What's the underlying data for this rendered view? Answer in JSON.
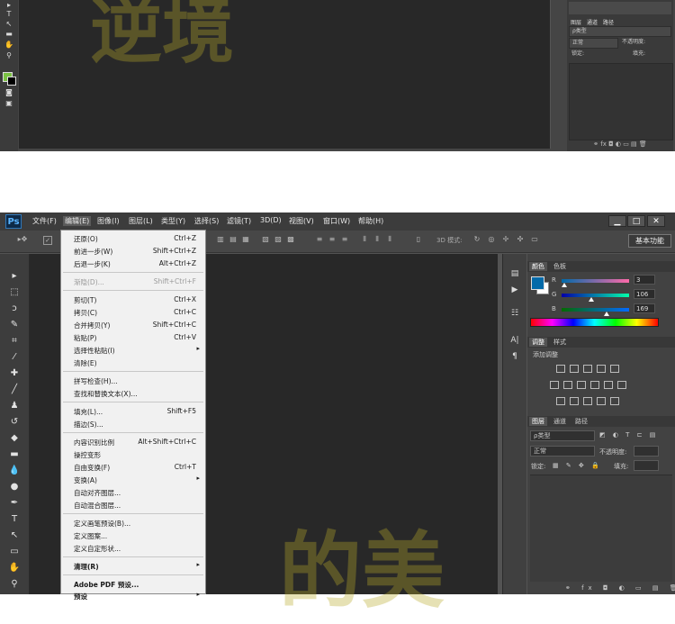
{
  "top_window": {
    "panel_tabs": [
      "图层",
      "通道",
      "路径"
    ],
    "panel_rows": [
      "ρ类型",
      "正常",
      "不透明度:",
      "锁定:",
      "填充:"
    ]
  },
  "app": {
    "logo": "Ps",
    "menus": [
      "文件(F)",
      "编辑(E)",
      "图像(I)",
      "图层(L)",
      "类型(Y)",
      "选择(S)",
      "滤镜(T)",
      "3D(D)",
      "视图(V)",
      "窗口(W)",
      "帮助(H)"
    ],
    "active_menu": "编辑(E)",
    "window_buttons": {
      "minimize": "▁",
      "maximize": "□",
      "close": "✕"
    }
  },
  "options_bar": {
    "mode_3d_label": "3D 模式:",
    "workspace_button": "基本功能"
  },
  "edit_menu": {
    "items": [
      {
        "label": "还原(O)",
        "shortcut": "Ctrl+Z"
      },
      {
        "label": "前进一步(W)",
        "shortcut": "Shift+Ctrl+Z"
      },
      {
        "label": "后退一步(K)",
        "shortcut": "Alt+Ctrl+Z"
      },
      {
        "label": "渐隐(D)...",
        "shortcut": "Shift+Ctrl+F"
      },
      {
        "label": "剪切(T)",
        "shortcut": "Ctrl+X"
      },
      {
        "label": "拷贝(C)",
        "shortcut": "Ctrl+C"
      },
      {
        "label": "合并拷贝(Y)",
        "shortcut": "Shift+Ctrl+C"
      },
      {
        "label": "粘贴(P)",
        "shortcut": "Ctrl+V"
      },
      {
        "label": "选择性粘贴(I)",
        "shortcut": ""
      },
      {
        "label": "清除(E)",
        "shortcut": ""
      },
      {
        "label": "拼写检查(H)...",
        "shortcut": ""
      },
      {
        "label": "查找和替换文本(X)...",
        "shortcut": ""
      },
      {
        "label": "填充(L)...",
        "shortcut": "Shift+F5"
      },
      {
        "label": "描边(S)...",
        "shortcut": ""
      },
      {
        "label": "内容识别比例",
        "shortcut": "Alt+Shift+Ctrl+C"
      },
      {
        "label": "操控变形",
        "shortcut": ""
      },
      {
        "label": "自由变换(F)",
        "shortcut": "Ctrl+T"
      },
      {
        "label": "变换(A)",
        "shortcut": ""
      },
      {
        "label": "自动对齐图层...",
        "shortcut": ""
      },
      {
        "label": "自动混合图层...",
        "shortcut": ""
      },
      {
        "label": "定义画笔预设(B)...",
        "shortcut": ""
      },
      {
        "label": "定义图案...",
        "shortcut": ""
      },
      {
        "label": "定义自定形状...",
        "shortcut": ""
      },
      {
        "label": "清理(R)",
        "shortcut": ""
      },
      {
        "label": "Adobe PDF 预设...",
        "shortcut": ""
      },
      {
        "label": "预设",
        "shortcut": ""
      }
    ]
  },
  "color_panel": {
    "tabs": [
      "颜色",
      "色板"
    ],
    "r_label": "R",
    "r_value": "3",
    "g_label": "G",
    "g_value": "106",
    "b_label": "B",
    "b_value": "169",
    "foreground": "#036aa9"
  },
  "adjustments_panel": {
    "tabs": [
      "调整",
      "样式"
    ],
    "title": "添加调整"
  },
  "layers_panel": {
    "tabs": [
      "图层",
      "通道",
      "路径"
    ],
    "kind_filter": "ρ类型",
    "blend_mode": "正常",
    "opacity_label": "不透明度:",
    "lock_label": "锁定:",
    "fill_label": "填充:"
  },
  "watermark": {
    "top": "逆境",
    "bottom": "的美"
  }
}
